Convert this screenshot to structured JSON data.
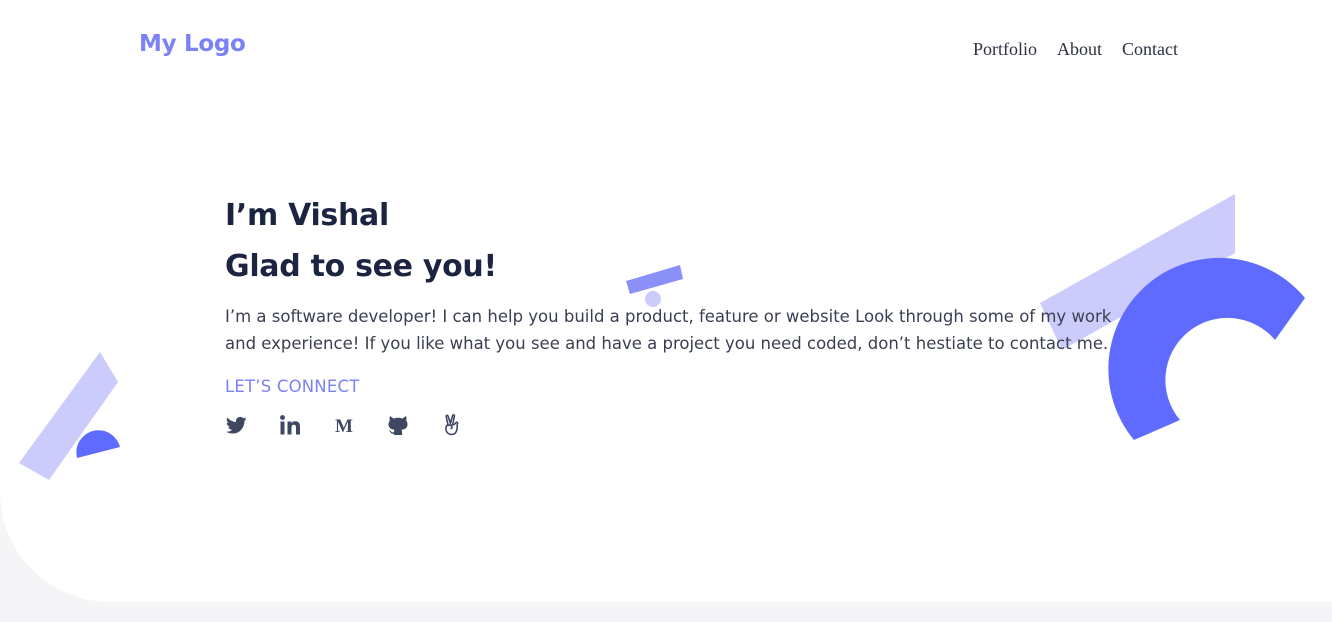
{
  "header": {
    "logo": "My Logo",
    "nav": [
      {
        "label": "Portfolio"
      },
      {
        "label": "About"
      },
      {
        "label": "Contact"
      }
    ]
  },
  "hero": {
    "greeting": "I’m Vishal",
    "subheading": "Glad to see you!",
    "description": "I’m a software developer! I can help you build a product, feature or website Look through some of my work and experience! If you like what you see and have a project you need coded, don’t hestiate to contact me.",
    "cta": "LET’S CONNECT",
    "socials": [
      {
        "icon": "twitter-icon"
      },
      {
        "icon": "linkedin-icon"
      },
      {
        "icon": "medium-icon"
      },
      {
        "icon": "github-icon"
      },
      {
        "icon": "angellist-icon"
      }
    ]
  },
  "colors": {
    "accent": "#7b82f7",
    "accent_dark": "#5f6bff",
    "accent_light": "#cbccfc",
    "heading": "#1b2541",
    "text": "#3a3f52",
    "icon": "#3f4863"
  }
}
